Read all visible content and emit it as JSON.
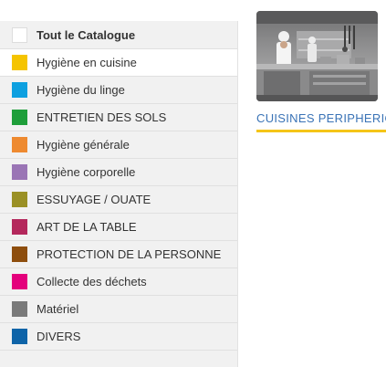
{
  "sidebar": {
    "header": {
      "label": "Tout le Catalogue",
      "color": "#ffffff"
    },
    "items": [
      {
        "label": "Hygiène en cuisine",
        "color": "#f5c400",
        "active": true
      },
      {
        "label": "Hygiène du linge",
        "color": "#0ea0e0"
      },
      {
        "label": "ENTRETIEN DES SOLS",
        "color": "#1e9e3a"
      },
      {
        "label": "Hygiène générale",
        "color": "#ee8a30"
      },
      {
        "label": "Hygiène corporelle",
        "color": "#9a75b5"
      },
      {
        "label": "ESSUYAGE / OUATE",
        "color": "#9a9025"
      },
      {
        "label": "ART DE LA TABLE",
        "color": "#b4285c"
      },
      {
        "label": "PROTECTION DE LA PERSONNE",
        "color": "#8e4e0e"
      },
      {
        "label": "Collecte des déchets",
        "color": "#e4007c"
      },
      {
        "label": "Matériel",
        "color": "#7a7a7a"
      },
      {
        "label": "DIVERS",
        "color": "#0f64a8"
      }
    ]
  },
  "card": {
    "title": "CUISINES PERIPHERIQUES",
    "title_color": "#3a73b6",
    "underline_color": "#f5c518",
    "image": "professional-kitchen-photo"
  }
}
